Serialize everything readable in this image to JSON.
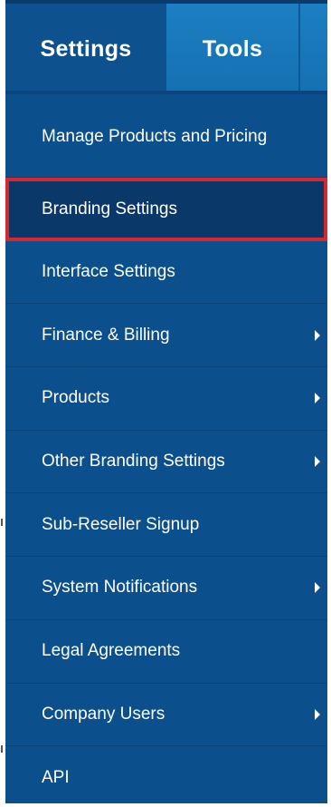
{
  "tabs": {
    "settings": "Settings",
    "tools": "Tools"
  },
  "menu": {
    "items": [
      {
        "label": "Manage Products and Pricing",
        "has_submenu": false,
        "selected": false
      },
      {
        "label": "Branding Settings",
        "has_submenu": false,
        "selected": true
      },
      {
        "label": "Interface Settings",
        "has_submenu": false,
        "selected": false
      },
      {
        "label": "Finance & Billing",
        "has_submenu": true,
        "selected": false
      },
      {
        "label": "Products",
        "has_submenu": true,
        "selected": false
      },
      {
        "label": "Other Branding Settings",
        "has_submenu": true,
        "selected": false
      },
      {
        "label": "Sub-Reseller Signup",
        "has_submenu": false,
        "selected": false
      },
      {
        "label": "System Notifications",
        "has_submenu": true,
        "selected": false
      },
      {
        "label": "Legal Agreements",
        "has_submenu": false,
        "selected": false
      },
      {
        "label": "Company Users",
        "has_submenu": true,
        "selected": false
      },
      {
        "label": "API",
        "has_submenu": false,
        "selected": false
      }
    ]
  },
  "colors": {
    "menu_bg": "#0b4f8c",
    "selected_bg": "#0a3868",
    "selected_border": "#d7262f",
    "tab_inactive": "#1a7cc0",
    "text": "#ffffff"
  },
  "icons": {
    "submenu": "chevron-right-icon"
  }
}
